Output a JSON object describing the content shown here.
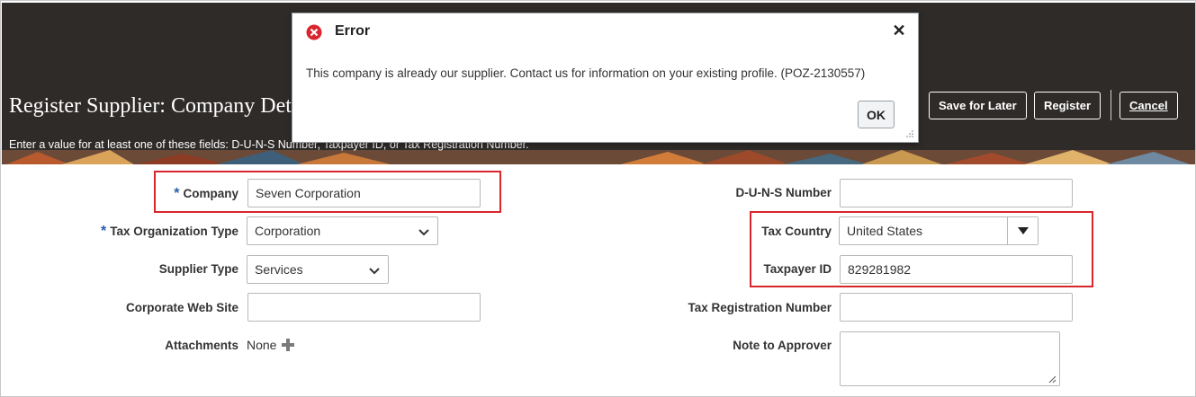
{
  "header": {
    "title": "Register Supplier: Company Details",
    "instruction": "Enter a value for at least one of these fields: D-U-N-S Number, Taxpayer ID, or Tax Registration Number.",
    "save_for_later": "Save for Later",
    "register": "Register",
    "cancel": "Cancel"
  },
  "form_left": {
    "required_marker": "*",
    "company_label": "Company",
    "company_value": "Seven Corporation",
    "tax_org_type_label": "Tax Organization Type",
    "tax_org_type_value": "Corporation",
    "supplier_type_label": "Supplier Type",
    "supplier_type_value": "Services",
    "web_site_label": "Corporate Web Site",
    "web_site_value": "",
    "attachments_label": "Attachments",
    "attachments_value": "None"
  },
  "form_right": {
    "duns_label": "D-U-N-S Number",
    "duns_value": "",
    "tax_country_label": "Tax Country",
    "tax_country_value": "United States",
    "taxpayer_id_label": "Taxpayer ID",
    "taxpayer_id_value": "829281982",
    "tax_reg_label": "Tax Registration Number",
    "tax_reg_value": "",
    "note_label": "Note to Approver",
    "note_value": ""
  },
  "dialog": {
    "title": "Error",
    "message": "This company is already our supplier. Contact us for information on your existing profile. (POZ-2130557)",
    "ok": "OK"
  },
  "colors": {
    "header_bg": "#2f2b29",
    "highlight": "#d9262e",
    "required": "#2a5fa8",
    "error_icon": "#d9262e"
  },
  "icons": {
    "dialog": "error-icon",
    "close": "close-icon",
    "add_attachment": "plus-icon",
    "dropdown": "chevron-down-icon",
    "combo": "caret-down-icon"
  }
}
